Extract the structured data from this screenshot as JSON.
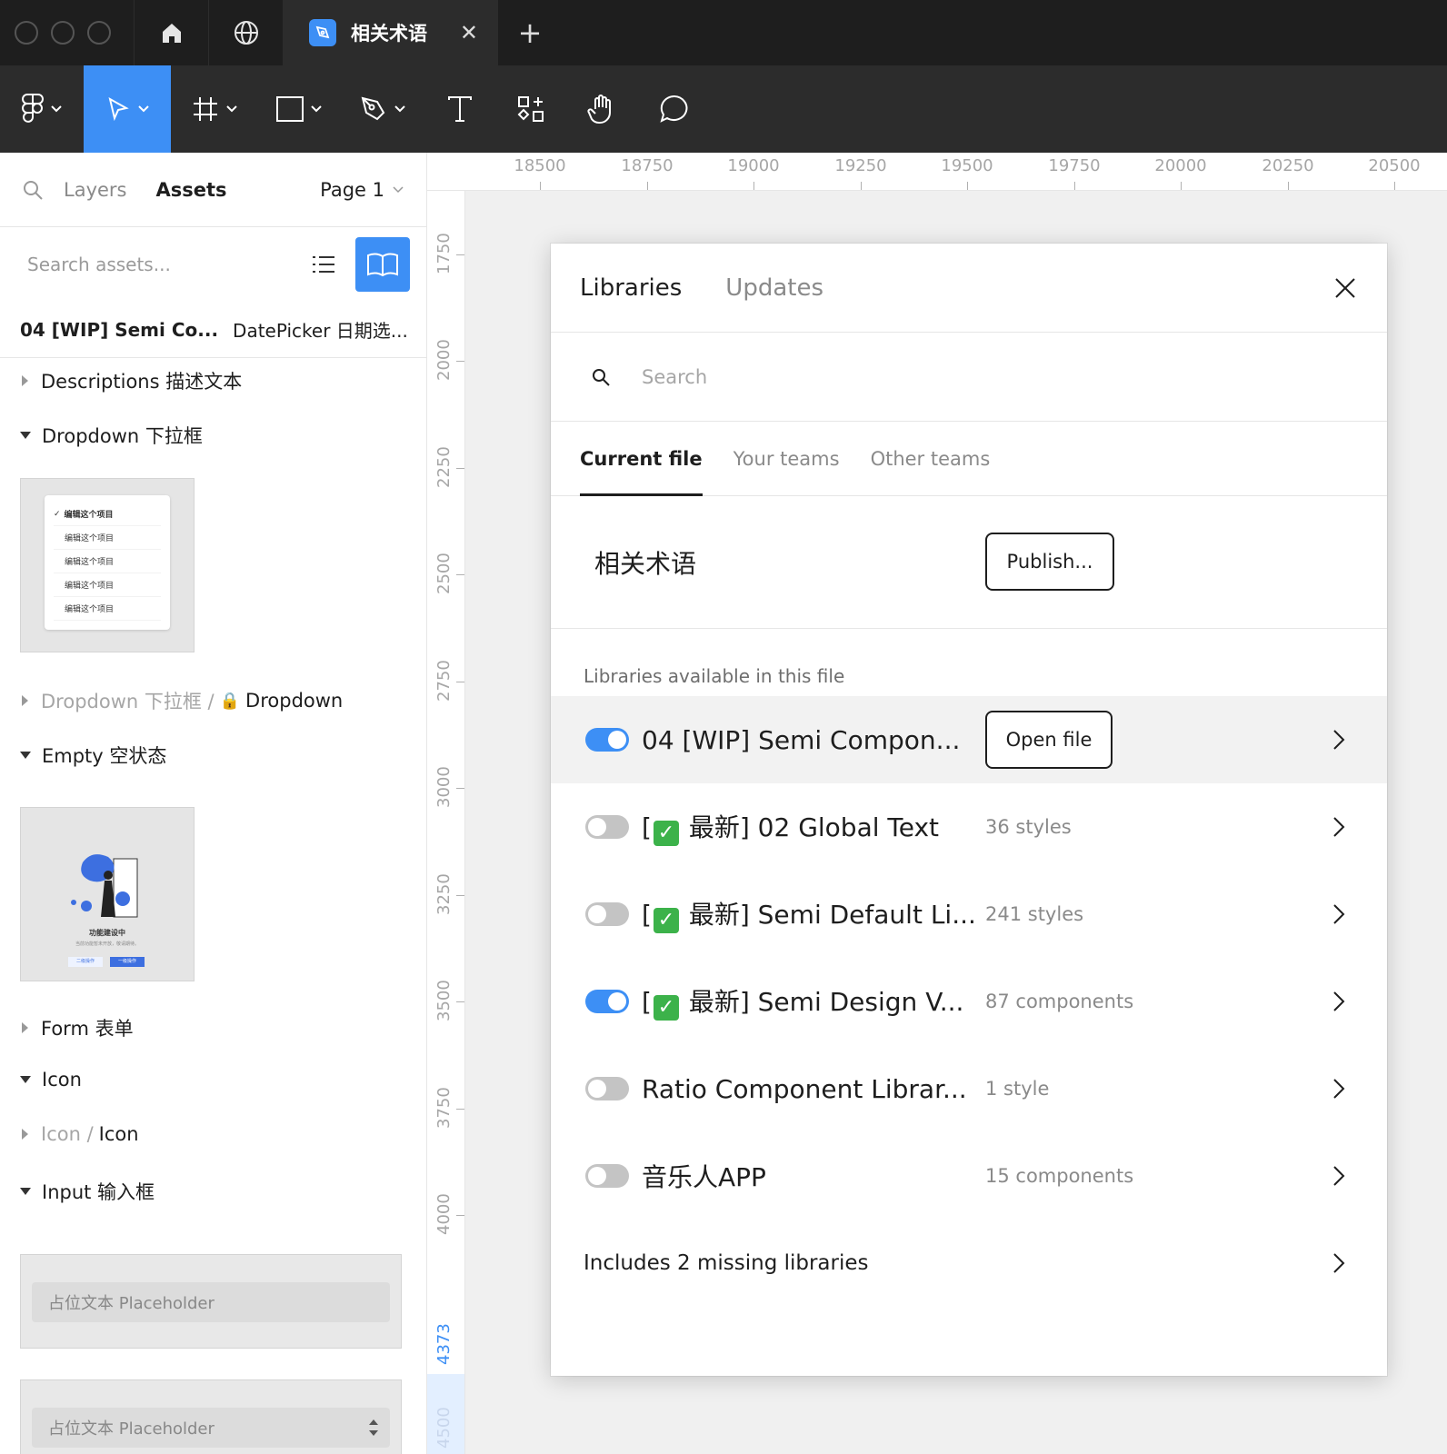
{
  "titlebar": {
    "tab_title": "相关术语",
    "close_glyph": "✕",
    "new_tab_glyph": "+"
  },
  "toolbar": {
    "tools": [
      "figma-menu",
      "move",
      "frame",
      "shape",
      "pen",
      "text",
      "resources",
      "hand",
      "comment"
    ],
    "active_tool": "move"
  },
  "left_panel": {
    "tab_layers": "Layers",
    "tab_assets": "Assets",
    "page_label": "Page 1",
    "search_placeholder": "Search assets...",
    "lib_crumb_name": "04 [WIP] Semi Co...",
    "lib_crumb_component": "DatePicker 日期选...",
    "sections": {
      "descriptions": "Descriptions 描述文本",
      "dropdown": "Dropdown 下拉框",
      "dropdown_path_prefix": "Dropdown 下拉框 /",
      "dropdown_path_item": "Dropdown",
      "empty": "Empty 空状态",
      "form": "Form 表单",
      "icon": "Icon",
      "icon_path_prefix": "Icon /",
      "icon_path_item": "Icon",
      "input": "Input 输入框"
    },
    "dropdown_preview_items": [
      "编辑这个项目",
      "编辑这个项目",
      "编辑这个项目",
      "编辑这个项目",
      "编辑这个项目"
    ],
    "empty_preview": {
      "title": "功能建设中",
      "desc": "当前功能暂未开放，敬请期待。",
      "btn_secondary": "二级操作",
      "btn_primary": "一级操作"
    },
    "input_placeholder_1": "占位文本 Placeholder",
    "input_placeholder_2": "占位文本 Placeholder"
  },
  "rulers": {
    "top": [
      "18500",
      "18750",
      "19000",
      "19250",
      "19500",
      "19750",
      "20000",
      "20250",
      "20500"
    ],
    "left": [
      "1750",
      "2000",
      "2250",
      "2500",
      "2750",
      "3000",
      "3250",
      "3500",
      "3750",
      "4000",
      "4373",
      "4500"
    ],
    "left_highlight": "4373"
  },
  "modal": {
    "tab_libraries": "Libraries",
    "tab_updates": "Updates",
    "search_placeholder": "Search",
    "scope_tabs": [
      "Current file",
      "Your teams",
      "Other teams"
    ],
    "active_scope": "Current file",
    "current_file_name": "相关术语",
    "publish_label": "Publish...",
    "available_heading": "Libraries available in this file",
    "libraries": [
      {
        "name": "04 [WIP] Semi Compon...",
        "meta": "",
        "enabled": true,
        "button": "Open file"
      },
      {
        "name_prefix": "[",
        "name_suffix": " 最新] 02 Global Text",
        "meta": "36 styles",
        "enabled": false
      },
      {
        "name_prefix": "[",
        "name_suffix": " 最新] Semi Default Li...",
        "meta": "241 styles",
        "enabled": false
      },
      {
        "name_prefix": "[",
        "name_suffix": " 最新] Semi Design V...",
        "meta": "87 components",
        "enabled": true
      },
      {
        "name": "Ratio Component Librar...",
        "meta": "1 style",
        "enabled": false
      },
      {
        "name": "音乐人APP",
        "meta": "15 components",
        "enabled": false
      }
    ],
    "check_glyph": "✓",
    "missing_label": "Includes 2 missing libraries"
  },
  "colors": {
    "accent": "#3d8ff5",
    "titlebar_bg": "#1e1e1e",
    "toolbar_bg": "#2c2c2c",
    "check_green": "#3cb24a"
  }
}
